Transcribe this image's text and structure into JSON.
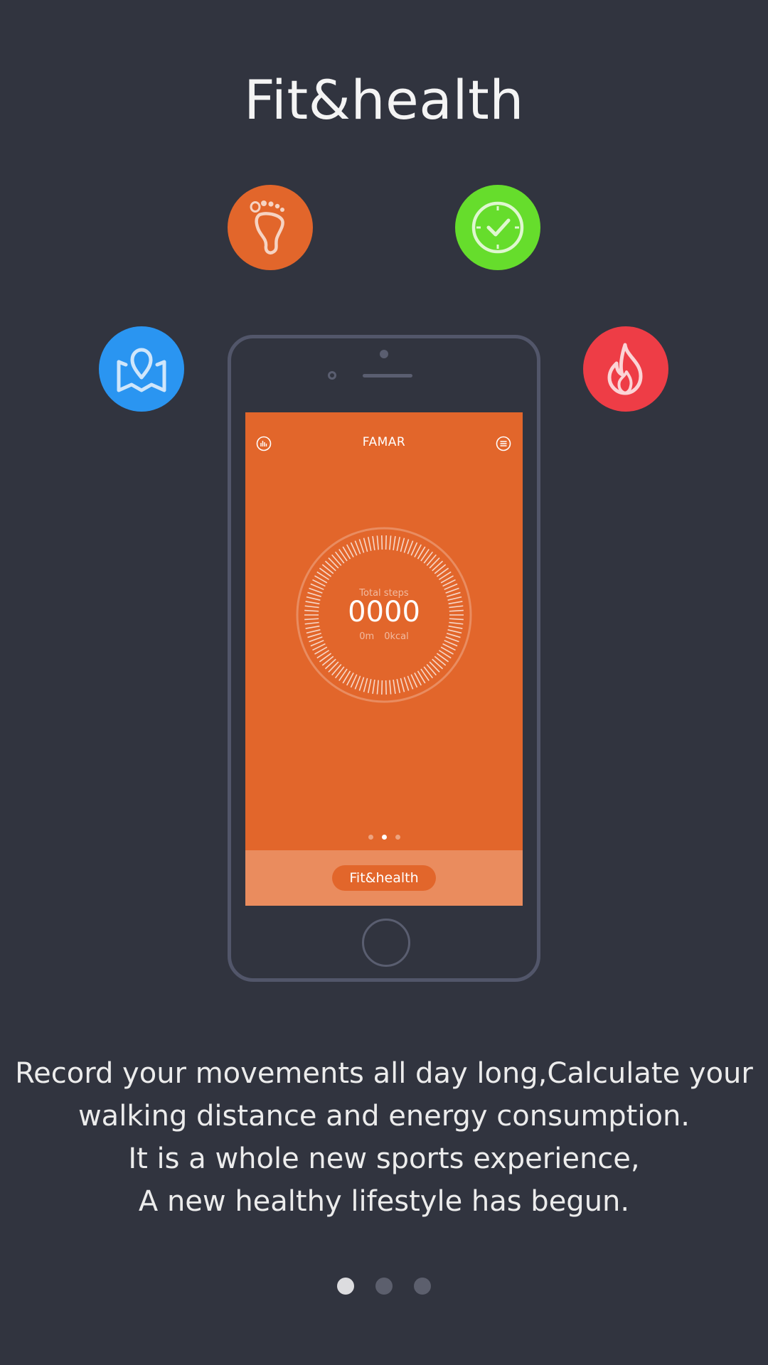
{
  "page": {
    "title": "Fit&health"
  },
  "features": [
    {
      "icon": "footprint-icon",
      "color": "#e2662b"
    },
    {
      "icon": "clock-check-icon",
      "color": "#66dd2c"
    },
    {
      "icon": "map-pin-icon",
      "color": "#2a95f1"
    },
    {
      "icon": "flame-icon",
      "color": "#ee3d46"
    }
  ],
  "app_screen": {
    "header_title": "FAMAR",
    "left_icon": "stats-icon",
    "right_icon": "menu-icon",
    "ring": {
      "label": "Total steps",
      "value": "0000",
      "distance": "0m",
      "calories": "0kcal"
    },
    "carousel": {
      "count": 3,
      "active_index": 1
    },
    "bottom_button": "Fit&health",
    "colors": {
      "primary": "#e2662b",
      "bottom_bar": "#ea8c5e"
    }
  },
  "description": {
    "line1": "Record your movements all day long,Calculate your",
    "line2": "walking distance and energy consumption.",
    "line3": "It is a whole new sports experience,",
    "line4": "A new healthy lifestyle has begun."
  },
  "pager": {
    "count": 3,
    "active_index": 0
  },
  "colors": {
    "background": "#31343f"
  }
}
